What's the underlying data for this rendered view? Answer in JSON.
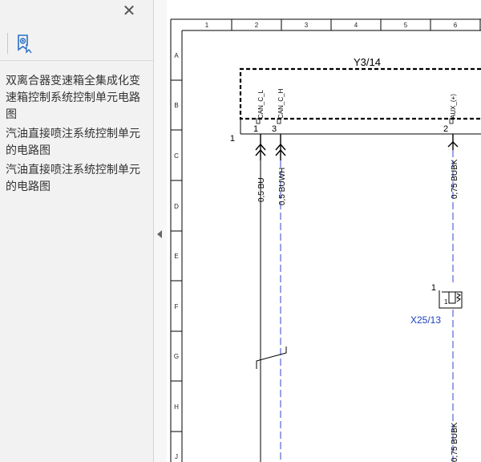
{
  "sidebar": {
    "close_icon": "close-icon",
    "toolbar_icon": "bookmark-icon",
    "bookmarks": [
      "双离合器变速箱全集成化变速箱控制系统控制单元电路图",
      "汽油直接喷注系统控制单元的电路图",
      "汽油直接喷注系统控制单元的电路图"
    ]
  },
  "splitter": {
    "collapse_icon": "collapse-left-icon"
  },
  "diagram": {
    "columns": [
      "1",
      "2",
      "3",
      "4",
      "5",
      "6"
    ],
    "rows": [
      "A",
      "B",
      "C",
      "D",
      "E",
      "F",
      "G",
      "H",
      "J"
    ],
    "component_id": "Y3/14",
    "pin_labels": [
      "CAN_C_L",
      "CAN_C_H",
      "AUX_(+)"
    ],
    "pin_numbers": [
      "1",
      "3",
      "2"
    ],
    "component_ref_number": "1",
    "wires": [
      "0,5 BU",
      "0,5 BUWH",
      "0,75 BUBK",
      "0,75 BUBK"
    ],
    "connector_id": "X25/13",
    "connector_number": "1",
    "connector_pin": "1",
    "colors": {
      "wire_blue": "#3344cc",
      "connector_label": "#1a3fbf",
      "line_black": "#000000"
    }
  }
}
